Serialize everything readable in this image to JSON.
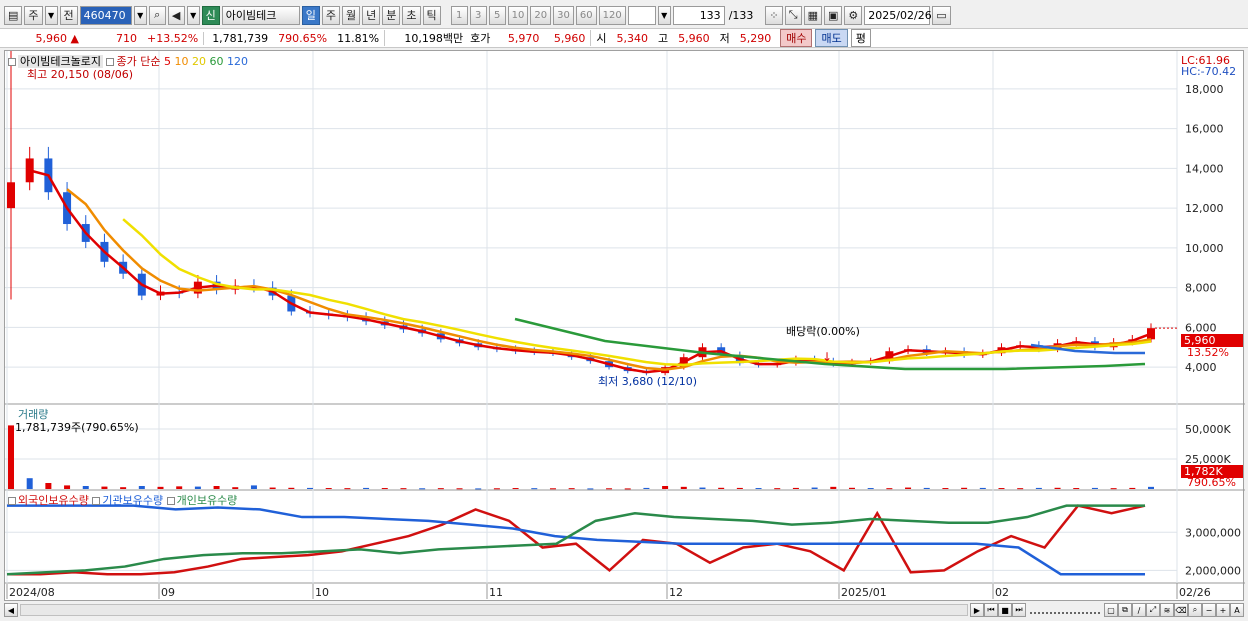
{
  "toolbar": {
    "market": "주",
    "mode": "전",
    "code": "460470",
    "new_badge": "신",
    "stock_name": "아이빔테크",
    "periods": [
      "일",
      "주",
      "월",
      "년",
      "분",
      "초",
      "틱"
    ],
    "active_period": "일",
    "intervals": [
      "1",
      "3",
      "5",
      "10",
      "20",
      "30",
      "60",
      "120"
    ],
    "count": "133",
    "count_total": "/133",
    "date": "2025/02/26"
  },
  "quote": {
    "price": "5,960",
    "change": "710",
    "change_pct": "+13.52%",
    "volume": "1,781,739",
    "volume_ratio": "790.65%",
    "turnover": "11.81%",
    "amount": "10,198백만",
    "ask_label": "호가",
    "ask": "5,970",
    "bid": "5,960",
    "open_label": "시",
    "open": "5,340",
    "high_label": "고",
    "high": "5,960",
    "low_label": "저",
    "low": "5,290",
    "buy": "매수",
    "sell": "매도",
    "eval": "평"
  },
  "price_panel": {
    "legend_name": "아이빔테크놀로지",
    "legend_ma_label": "종가 단순",
    "ma_periods": [
      "5",
      "10",
      "20",
      "60",
      "120"
    ],
    "ma_colors": {
      "5": "#e00000",
      "10": "#f08c00",
      "20": "#f0e000",
      "60": "#2a9a3a",
      "120": "#2a6ad8"
    },
    "high_annotation": "최고 20,150 (08/06)",
    "low_annotation": "최저 3,680 (12/10)",
    "dividend_annotation": "배당락(0.00%)",
    "lc": "LC:61.96",
    "hc": "HC:-70.42",
    "y_ticks": [
      "18,000",
      "16,000",
      "14,000",
      "12,000",
      "10,000",
      "8,000",
      "6,000",
      "4,000"
    ],
    "last_price_tag": "5,960",
    "last_pct_tag": "13.52%"
  },
  "volume_panel": {
    "title": "거래량",
    "current": "1,781,739주(790.65%)",
    "y_ticks": [
      "50,000K",
      "25,000K"
    ],
    "last_tag": "1,782K",
    "last_pct_tag": "790.65%"
  },
  "holdings_panel": {
    "series_labels": [
      "외국인보유수량",
      "기관보유수량",
      "개인보유수량"
    ],
    "y_ticks": [
      "3,000,000",
      "2,000,000"
    ]
  },
  "x_axis": {
    "labels": [
      "2024/08",
      "09",
      "10",
      "11",
      "12",
      "2025/01",
      "02",
      "02/26"
    ]
  },
  "chart_data": [
    {
      "type": "candlestick",
      "title": "아이빔테크놀로지",
      "x": [
        "2024/08",
        "09",
        "10",
        "11",
        "12",
        "2025/01",
        "02",
        "02/26"
      ],
      "ylim": [
        3000,
        20000
      ],
      "close": [
        13300,
        14500,
        12800,
        11200,
        10300,
        9300,
        8700,
        7600,
        7800,
        7700,
        8300,
        7900,
        8100,
        8000,
        7600,
        6800,
        6700,
        6600,
        6500,
        6300,
        6100,
        5900,
        5700,
        5400,
        5200,
        5000,
        4900,
        4800,
        4750,
        4700,
        4500,
        4300,
        4000,
        3800,
        3700,
        4000,
        4500,
        5000,
        4600,
        4200,
        4100,
        4200,
        4400,
        4300,
        4150,
        4250,
        4300,
        4800,
        4900,
        4700,
        4800,
        4600,
        4700,
        5000,
        5100,
        4900,
        5200,
        5300,
        5000,
        5250,
        5400,
        5960
      ],
      "ma": {
        "5": "red",
        "10": "orange",
        "20": "yellow",
        "60": "green",
        "120": "blue"
      },
      "high": 20150,
      "high_date": "08/06",
      "low": 3680,
      "low_date": "12/10",
      "last": 5960,
      "last_change_pct": 13.52
    },
    {
      "type": "bar",
      "title": "거래량",
      "ylim": [
        0,
        60000
      ],
      "values_k": [
        53000,
        9000,
        5000,
        3000,
        2500,
        2000,
        1500,
        2500,
        1800,
        2200,
        2000,
        2500,
        1500,
        3000,
        1200,
        1000,
        900,
        800,
        700,
        900,
        800,
        700,
        600,
        700,
        600,
        500,
        600,
        800,
        700,
        600,
        700,
        500,
        600,
        500,
        900,
        2500,
        1800,
        1200,
        1000,
        900,
        800,
        700,
        900,
        1200,
        1800,
        1000,
        800,
        700,
        1200,
        900,
        800,
        1000,
        900,
        800,
        700,
        900,
        1000,
        800,
        900,
        700,
        900,
        1782
      ],
      "last": "1,782K"
    },
    {
      "type": "line",
      "title": "보유수량",
      "ylim": [
        1800000,
        3900000
      ],
      "series": [
        {
          "name": "외국인보유수량",
          "color": "#d01010",
          "values": [
            1900000,
            1900000,
            1950000,
            1900000,
            1900000,
            1950000,
            2100000,
            2300000,
            2350000,
            2400000,
            2500000,
            2700000,
            2900000,
            3200000,
            3600000,
            3300000,
            2600000,
            2700000,
            2000000,
            2800000,
            2700000,
            2200000,
            2600000,
            2700000,
            2500000,
            2000000,
            3500000,
            1950000,
            2000000,
            2500000,
            2900000,
            2600000,
            3700000,
            3500000,
            3700000
          ]
        },
        {
          "name": "기관보유수량",
          "color": "#2060d8",
          "values": [
            3700000,
            3700000,
            3700000,
            3700000,
            3600000,
            3650000,
            3600000,
            3400000,
            3400000,
            3350000,
            3300000,
            3200000,
            3100000,
            2900000,
            2800000,
            2750000,
            2700000,
            2700000,
            2700000,
            2700000,
            2700000,
            2700000,
            2700000,
            2700000,
            2600000,
            1900000,
            1900000,
            1900000
          ]
        },
        {
          "name": "개인보유수량",
          "color": "#2a8a4a",
          "values": [
            1900000,
            1950000,
            2000000,
            2100000,
            2300000,
            2400000,
            2450000,
            2450000,
            2500000,
            2550000,
            2450000,
            2550000,
            2600000,
            2650000,
            2700000,
            3300000,
            3500000,
            3400000,
            3350000,
            3300000,
            3200000,
            3250000,
            3350000,
            3300000,
            3250000,
            3250000,
            3400000,
            3700000,
            3700000,
            3700000
          ]
        }
      ]
    }
  ]
}
